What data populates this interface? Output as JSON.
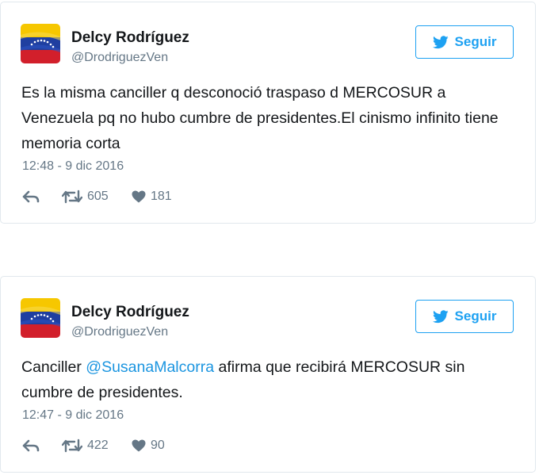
{
  "colors": {
    "accent": "#1da1f2",
    "mention": "#1b95e0",
    "text": "#14171a",
    "muted": "#657786",
    "border": "#e1e8ed"
  },
  "tweets": [
    {
      "author": {
        "name": "Delcy Rodríguez",
        "handle": "@DrodriguezVen",
        "avatar_icon": "venezuela-flag-avatar"
      },
      "follow_label": "Seguir",
      "follow_icon": "twitter-bird-icon",
      "text": "Es la misma canciller q desconoció traspaso d MERCOSUR a Venezuela pq no hubo cumbre de presidentes.El cinismo infinito tiene memoria corta",
      "date": "12:48 - 9 dic 2016",
      "retweets": "605",
      "likes": "181"
    },
    {
      "author": {
        "name": "Delcy Rodríguez",
        "handle": "@DrodriguezVen",
        "avatar_icon": "venezuela-flag-avatar"
      },
      "follow_label": "Seguir",
      "follow_icon": "twitter-bird-icon",
      "text_before": "Canciller ",
      "mention": "@SusanaMalcorra",
      "text_after": " afirma que recibirá MERCOSUR sin cumbre de presidentes.",
      "date": "12:47 - 9 dic 2016",
      "retweets": "422",
      "likes": "90"
    }
  ]
}
